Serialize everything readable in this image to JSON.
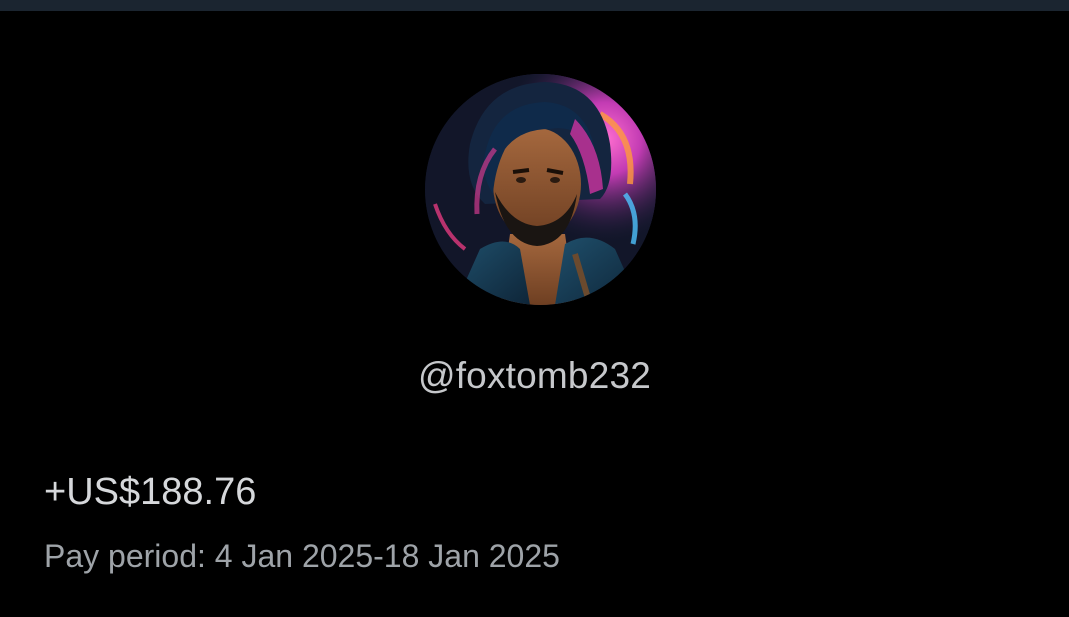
{
  "profile": {
    "avatar_alt": "profile avatar",
    "handle": "@foxtomb232"
  },
  "payout": {
    "amount": "+US$188.76",
    "period": "Pay period: 4 Jan 2025-18 Jan 2025"
  },
  "colors": {
    "background": "#000000",
    "top_strip": "#1b2530",
    "handle_text": "#c6c8cb",
    "amount_text": "#d6d8db",
    "period_text": "#9ea3a8"
  }
}
